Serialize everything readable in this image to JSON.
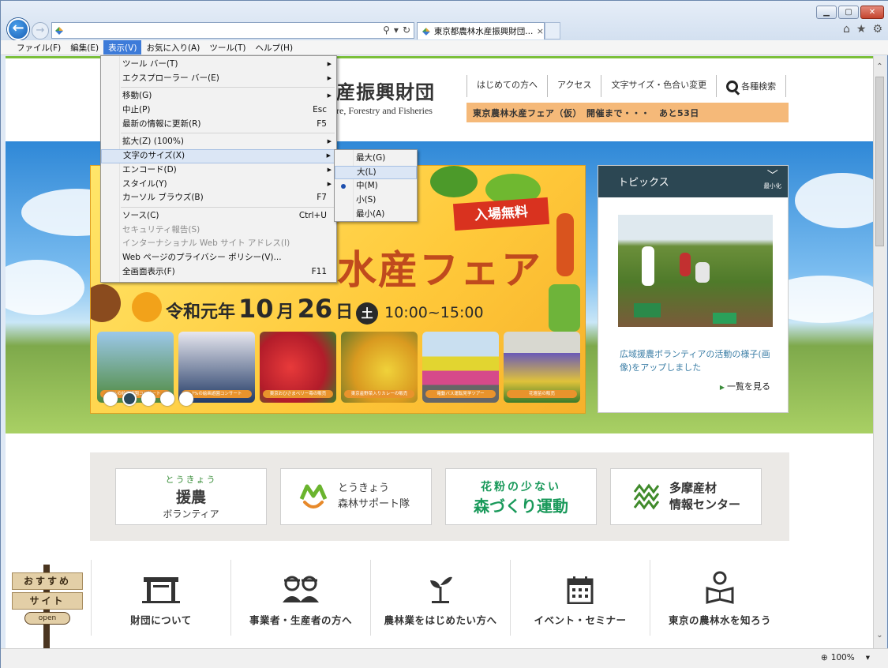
{
  "browser": {
    "tab_title": "東京都農林水産振興財団...",
    "tab_close": "×",
    "address_value": "",
    "zoom": "100%",
    "window_controls": [
      "minimize",
      "maximize",
      "close"
    ],
    "toolbar_icons": [
      "home-icon",
      "star-icon",
      "gear-icon"
    ]
  },
  "menubar": [
    "ファイル(F)",
    "編集(E)",
    "表示(V)",
    "お気に入り(A)",
    "ツール(T)",
    "ヘルプ(H)"
  ],
  "view_menu": [
    {
      "label": "ツール バー(T)",
      "shortcut": "",
      "submenu": true,
      "disabled": false
    },
    {
      "label": "エクスプローラー バー(E)",
      "shortcut": "",
      "submenu": true,
      "disabled": false
    },
    {
      "sep": true
    },
    {
      "label": "移動(G)",
      "shortcut": "",
      "submenu": true,
      "disabled": false
    },
    {
      "label": "中止(P)",
      "shortcut": "Esc",
      "submenu": false,
      "disabled": false
    },
    {
      "label": "最新の情報に更新(R)",
      "shortcut": "F5",
      "submenu": false,
      "disabled": false
    },
    {
      "sep": true
    },
    {
      "label": "拡大(Z) (100%)",
      "shortcut": "",
      "submenu": true,
      "disabled": false
    },
    {
      "label": "文字のサイズ(X)",
      "shortcut": "",
      "submenu": true,
      "disabled": false,
      "highlight": true
    },
    {
      "label": "エンコード(D)",
      "shortcut": "",
      "submenu": true,
      "disabled": false
    },
    {
      "label": "スタイル(Y)",
      "shortcut": "",
      "submenu": true,
      "disabled": false
    },
    {
      "label": "カーソル ブラウズ(B)",
      "shortcut": "F7",
      "submenu": false,
      "disabled": false
    },
    {
      "sep": true
    },
    {
      "label": "ソース(C)",
      "shortcut": "Ctrl+U",
      "submenu": false,
      "disabled": false
    },
    {
      "label": "セキュリティ報告(S)",
      "shortcut": "",
      "submenu": false,
      "disabled": true
    },
    {
      "label": "インターナショナル Web サイト アドレス(I)",
      "shortcut": "",
      "submenu": false,
      "disabled": true
    },
    {
      "label": "Web ページのプライバシー ポリシー(V)...",
      "shortcut": "",
      "submenu": false,
      "disabled": false
    },
    {
      "label": "全画面表示(F)",
      "shortcut": "F11",
      "submenu": false,
      "disabled": false
    }
  ],
  "text_size_menu": [
    {
      "label": "最大(G)",
      "selected": false,
      "highlight": false
    },
    {
      "label": "大(L)",
      "selected": false,
      "highlight": true
    },
    {
      "label": "中(M)",
      "selected": true,
      "highlight": false
    },
    {
      "label": "小(S)",
      "selected": false,
      "highlight": false
    },
    {
      "label": "最小(A)",
      "selected": false,
      "highlight": false
    }
  ],
  "site": {
    "title_fragment": "産振興財団",
    "subtitle_fragment": "re, Forestry and Fisheries",
    "nav": [
      "はじめての方へ",
      "アクセス",
      "文字サイズ・色合い変更",
      "各種検索"
    ],
    "countdown": "東京農林水産フェア（仮）　開催まで・・・　あと53日"
  },
  "banner": {
    "free": "入場無料",
    "title": "水産フェア",
    "date_era": "令和元年",
    "date_month": "10",
    "date_m_unit": "月",
    "date_day": "26",
    "date_d_unit": "日",
    "date_dow": "土",
    "time": "10:00~15:00",
    "photo_captions": [
      "7%の絵画遊園コンサート",
      "東京おひさまベリー苺の販売",
      "東京産野菜入りカレーの販売",
      "電動バス運転見学ツアー",
      "花壇苗の販売"
    ],
    "slider_dots": 5,
    "slider_active": 1
  },
  "topics": {
    "heading": "トピックス",
    "minimize": "最小化",
    "text": "広域援農ボランティアの活動の様子(画像)をアップしました",
    "more": "一覧を見る"
  },
  "partners": {
    "enno": {
      "top": "とうきょう",
      "main": "援農",
      "sub": "ボランティア"
    },
    "forest": {
      "line1": "とうきょう",
      "line2": "森林サポート隊"
    },
    "kafun": {
      "line1": "花粉の少ない",
      "line2": "森づくり運動"
    },
    "tama": {
      "line1": "多摩産材",
      "line2": "情報センター"
    }
  },
  "osusume": {
    "line1": "おすすめ",
    "line2": "サイト",
    "open": "open"
  },
  "bottom_nav": [
    "財団について",
    "事業者・生産者の方へ",
    "農林業をはじめたい方へ",
    "イベント・セミナー",
    "東京の農林水を知ろう"
  ]
}
